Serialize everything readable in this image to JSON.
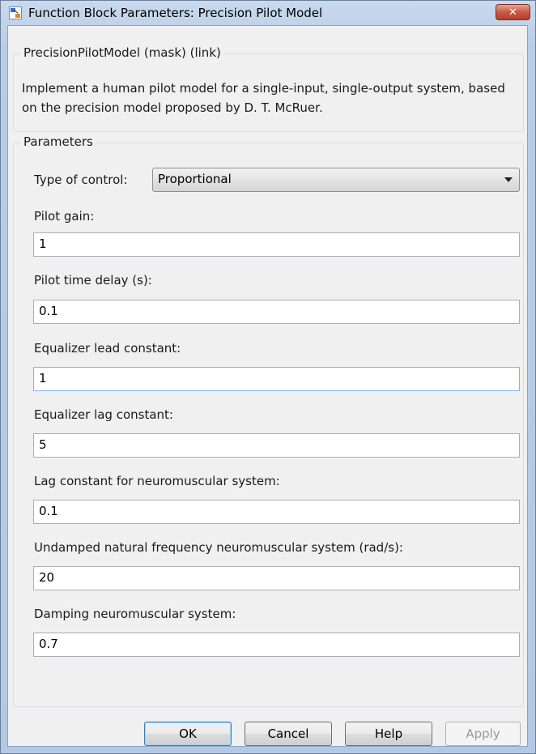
{
  "window": {
    "title": "Function Block Parameters: Precision Pilot Model",
    "close_label": "✕"
  },
  "mask": {
    "legend": "PrecisionPilotModel (mask) (link)",
    "description": "Implement a human pilot model for a single-input, single-output system, based on the precision model proposed by D. T. McRuer."
  },
  "parameters": {
    "legend": "Parameters",
    "type_of_control": {
      "label": "Type of control:",
      "value": "Proportional"
    },
    "fields": [
      {
        "label": "Pilot gain:",
        "value": "1"
      },
      {
        "label": "Pilot time delay (s):",
        "value": "0.1"
      },
      {
        "label": "Equalizer lead constant:",
        "value": "1"
      },
      {
        "label": "Equalizer lag constant:",
        "value": "5"
      },
      {
        "label": "Lag constant for neuromuscular system:",
        "value": "0.1"
      },
      {
        "label": "Undamped natural frequency neuromuscular system (rad/s):",
        "value": "20"
      },
      {
        "label": "Damping neuromuscular system:",
        "value": "0.7"
      }
    ]
  },
  "buttons": {
    "ok": "OK",
    "cancel": "Cancel",
    "help": "Help",
    "apply": "Apply"
  }
}
